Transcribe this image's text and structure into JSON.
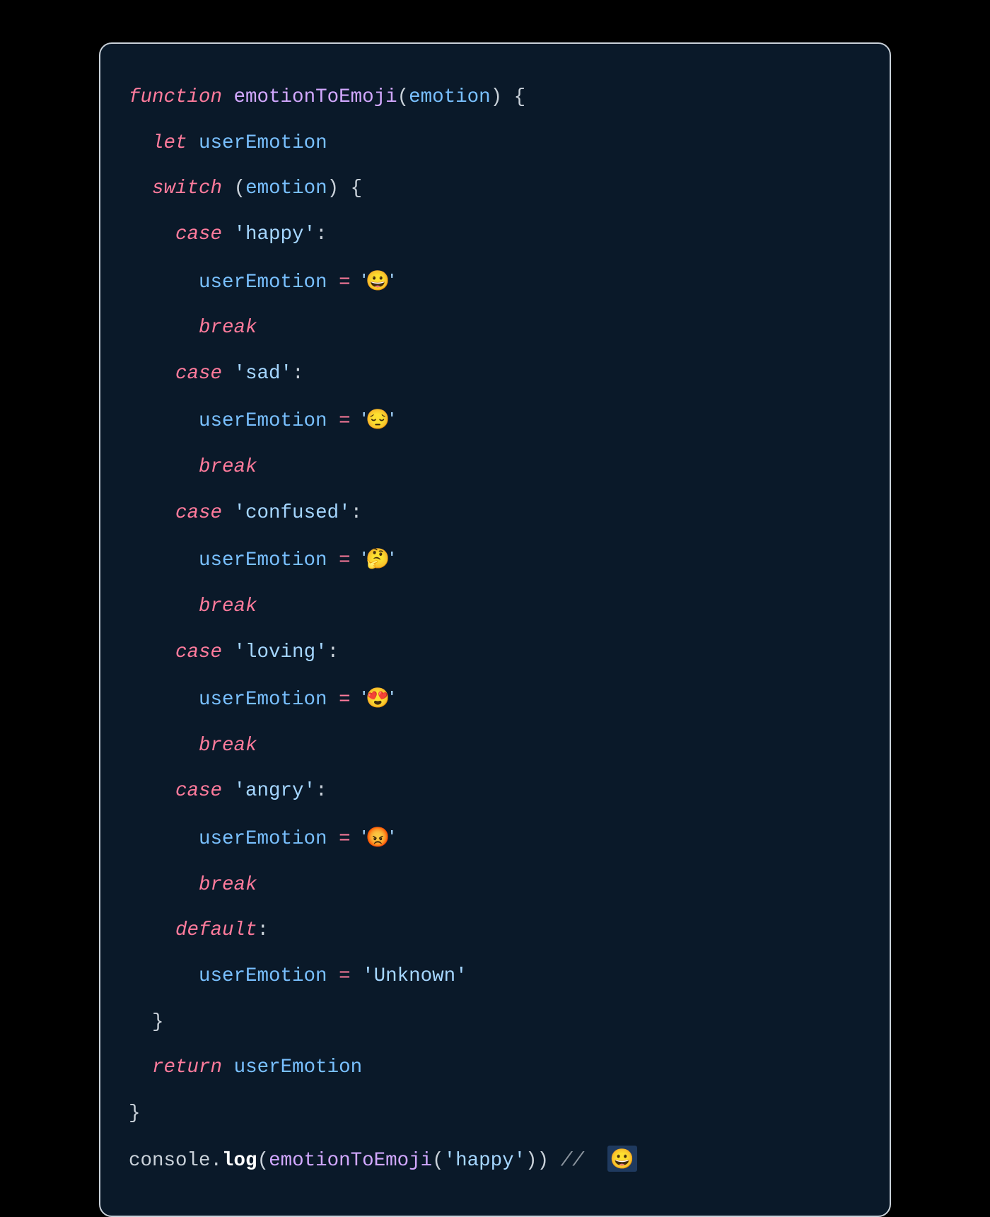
{
  "code": {
    "l1": {
      "kw_function": "function",
      "fn": "emotionToEmoji",
      "param": "emotion"
    },
    "l2": {
      "kw_let": "let",
      "var": "userEmotion"
    },
    "l3": {
      "kw_switch": "switch",
      "expr": "emotion"
    },
    "cases": [
      {
        "kw_case": "case",
        "label": "'happy'",
        "var": "userEmotion",
        "op": "=",
        "val": "'😀'",
        "kw_break": "break"
      },
      {
        "kw_case": "case",
        "label": "'sad'",
        "var": "userEmotion",
        "op": "=",
        "val": "'😔'",
        "kw_break": "break"
      },
      {
        "kw_case": "case",
        "label": "'confused'",
        "var": "userEmotion",
        "op": "=",
        "val": "'🤔'",
        "kw_break": "break"
      },
      {
        "kw_case": "case",
        "label": "'loving'",
        "var": "userEmotion",
        "op": "=",
        "val": "'😍'",
        "kw_break": "break"
      },
      {
        "kw_case": "case",
        "label": "'angry'",
        "var": "userEmotion",
        "op": "=",
        "val": "'😡'",
        "kw_break": "break"
      }
    ],
    "default": {
      "kw_default": "default",
      "var": "userEmotion",
      "op": "=",
      "val": "'Unknown'"
    },
    "ret": {
      "kw_return": "return",
      "var": "userEmotion"
    },
    "call": {
      "obj": "console",
      "mth": "log",
      "fn": "emotionToEmoji",
      "arg": "'happy'",
      "cmt": "//",
      "out": "😀"
    }
  },
  "colors": {
    "background_page": "#000000",
    "background_panel": "#0a1929",
    "border": "#c9d1d9",
    "keyword": "#ff7b9c",
    "function": "#d2a8ff",
    "identifier": "#79c0ff",
    "string": "#a5d6ff",
    "comment": "#8b949e",
    "highlight": "#1f3a5f"
  }
}
